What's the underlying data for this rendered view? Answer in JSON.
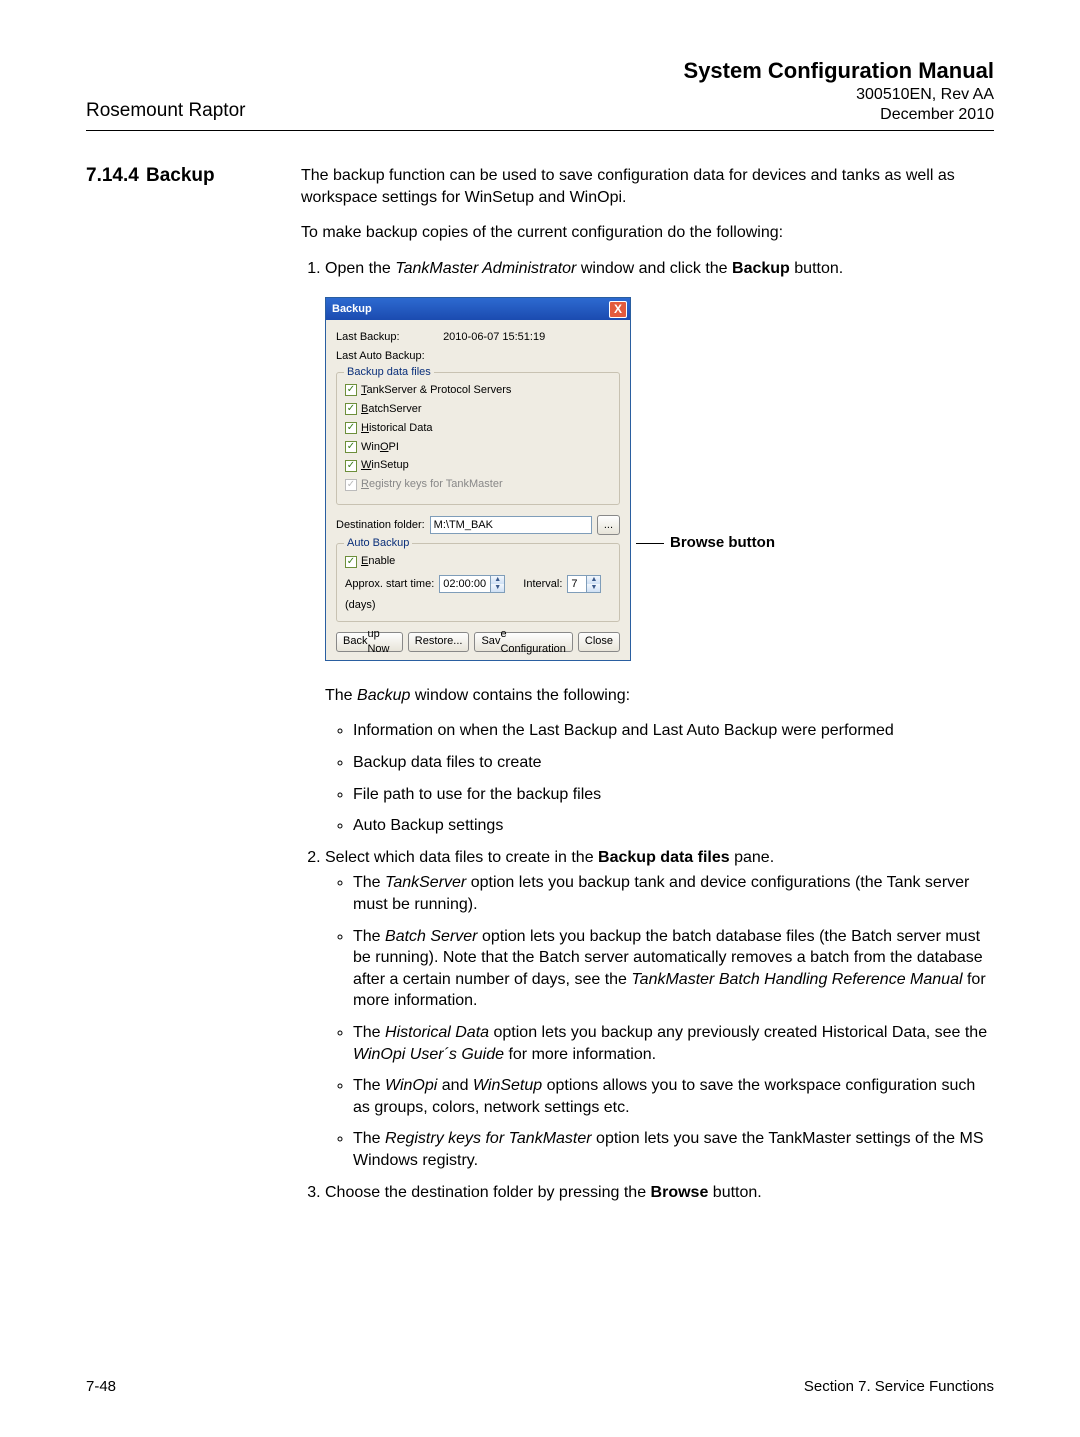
{
  "header": {
    "product": "Rosemount Raptor",
    "doc_title": "System Configuration Manual",
    "doc_code": "300510EN, Rev AA",
    "doc_date": "December 2010"
  },
  "section": {
    "number": "7.14.4",
    "title": "Backup",
    "intro1": "The backup function can be used to save configuration data for devices and tanks as well as workspace settings for WinSetup and WinOpi.",
    "intro2": "To make backup copies of the current configuration do the following:",
    "step1_a": "Open the ",
    "step1_b": "TankMaster Administrator",
    "step1_c": " window and click the ",
    "step1_d": "Backup",
    "step1_e": " button.",
    "after_fig_a": "The ",
    "after_fig_b": "Backup",
    "after_fig_c": " window contains the following:",
    "bullets1": {
      "b1": "Information on when the Last Backup and Last Auto Backup were performed",
      "b2": "Backup data files to create",
      "b3": "File path to use for the backup files",
      "b4": "Auto Backup settings"
    },
    "step2_a": "Select which data files to create in the ",
    "step2_b": "Backup data files",
    "step2_c": " pane.",
    "bullets2": {
      "b1_a": "The ",
      "b1_b": "TankServer",
      "b1_c": " option lets you backup tank and device configurations (the Tank server must be running).",
      "b2_a": "The ",
      "b2_b": "Batch Server",
      "b2_c": " option lets you backup the batch database files (the Batch server must be running). Note that the Batch server automatically removes a batch from the database after a certain number of days, see the ",
      "b2_d": "TankMaster Batch Handling Reference Manual",
      "b2_e": " for more information.",
      "b3_a": "The ",
      "b3_b": "Historical Data",
      "b3_c": " option lets you backup any previously created Historical Data, see the ",
      "b3_d": "WinOpi User´s Guide",
      "b3_e": " for more information.",
      "b4_a": "The ",
      "b4_b": "WinOpi",
      "b4_c": " and ",
      "b4_d": "WinSetup",
      "b4_e": " options allows you to save the workspace configuration such as groups, colors, network settings etc.",
      "b5_a": "The ",
      "b5_b": "Registry keys for TankMaster",
      "b5_c": " option lets you save the TankMaster settings of the MS Windows registry."
    },
    "step3_a": "Choose the destination folder by pressing the ",
    "step3_b": "Browse",
    "step3_c": " button."
  },
  "dialog": {
    "title": "Backup",
    "close": "X",
    "last_backup_label": "Last Backup:",
    "last_backup_value": "2010-06-07 15:51:19",
    "last_auto_label": "Last Auto Backup:",
    "group_backup": "Backup data files",
    "chk_tankserver": "TankServer & Protocol Servers",
    "chk_batch": "BatchServer",
    "chk_hist": "Historical Data",
    "chk_winopi": "WinOPI",
    "chk_winsetup": "WinSetup",
    "chk_registry": "Registry keys for TankMaster",
    "dest_label": "Destination folder:",
    "dest_value": "M:\\TM_BAK",
    "browse": "...",
    "group_auto": "Auto Backup",
    "chk_enable": "Enable",
    "approx_label": "Approx. start time:",
    "approx_value": "02:00:00",
    "interval_label": "Interval:",
    "interval_value": "7",
    "interval_unit": "(days)",
    "btn_backup_now": "Backup Now",
    "btn_restore": "Restore...",
    "btn_save": "Save Configuration",
    "btn_close": "Close"
  },
  "callout": "Browse button",
  "footer": {
    "left": "7-48",
    "right": "Section 7. Service Functions"
  }
}
